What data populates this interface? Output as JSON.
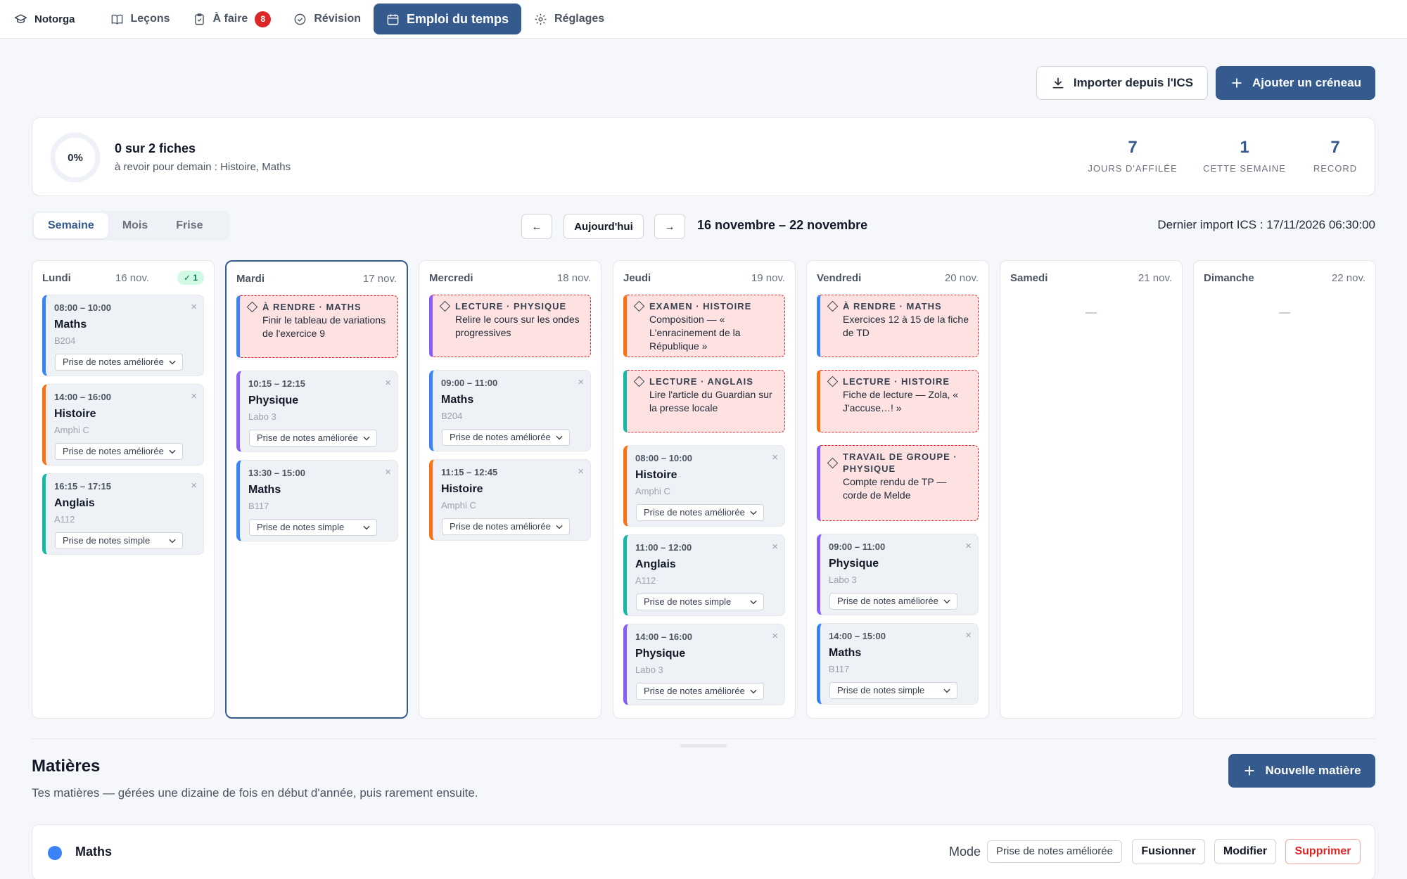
{
  "colors": {
    "accent": "#345a8e",
    "maths": "#3b82f6",
    "physique": "#8b5cf6",
    "histoire": "#f97316",
    "anglais": "#14b8a6",
    "danger": "#dc2626"
  },
  "nav": {
    "brand": "Notorga",
    "items": [
      {
        "label": "Leçons",
        "icon": "book-icon"
      },
      {
        "label": "À faire",
        "icon": "clipboard-icon",
        "badge": "8"
      },
      {
        "label": "Révision",
        "icon": "check-circle-icon"
      },
      {
        "label": "Emploi du temps",
        "icon": "calendar-icon",
        "active": true
      },
      {
        "label": "Réglages",
        "icon": "gear-icon"
      }
    ]
  },
  "actions": {
    "import_label": "Importer depuis l'ICS",
    "add_slot_label": "Ajouter un créneau"
  },
  "progress": {
    "percent_label": "0%",
    "percent": 0,
    "title": "0 sur 2 fiches",
    "subtitle": "à revoir pour demain : Histoire, Maths",
    "stats": [
      {
        "value": "7",
        "label": "Jours d'affilée"
      },
      {
        "value": "1",
        "label": "Cette semaine"
      },
      {
        "value": "7",
        "label": "Record"
      }
    ]
  },
  "toolbar": {
    "views": [
      "Semaine",
      "Mois",
      "Frise"
    ],
    "active_view": "Semaine",
    "prev": "←",
    "today": "Aujourd'hui",
    "next": "→",
    "range": "16 novembre – 22 novembre",
    "last_import": "Dernier import ICS : 17/11/2026 06:30:00"
  },
  "week": [
    {
      "name": "Lundi",
      "date": "16 nov.",
      "check": "✓ 1",
      "tasks": [],
      "slots": [
        {
          "time": "08:00 – 10:00",
          "subject": "Maths",
          "room": "B204",
          "mode": "Prise de notes améliorée",
          "color": "maths"
        },
        {
          "time": "14:00 – 16:00",
          "subject": "Histoire",
          "room": "Amphi C",
          "mode": "Prise de notes améliorée",
          "color": "histoire"
        },
        {
          "time": "16:15 – 17:15",
          "subject": "Anglais",
          "room": "A112",
          "mode": "Prise de notes simple",
          "color": "anglais"
        }
      ]
    },
    {
      "name": "Mardi",
      "date": "17 nov.",
      "today": true,
      "tasks": [
        {
          "kind": "À RENDRE · MATHS",
          "desc": "Finir le tableau de variations de l'exercice 9",
          "color": "maths"
        }
      ],
      "slots": [
        {
          "time": "10:15 – 12:15",
          "subject": "Physique",
          "room": "Labo 3",
          "mode": "Prise de notes améliorée",
          "color": "physique"
        },
        {
          "time": "13:30 – 15:00",
          "subject": "Maths",
          "room": "B117",
          "mode": "Prise de notes simple",
          "color": "maths"
        }
      ]
    },
    {
      "name": "Mercredi",
      "date": "18 nov.",
      "tasks": [
        {
          "kind": "LECTURE · PHYSIQUE",
          "desc": "Relire le cours sur les ondes progressives",
          "color": "physique"
        }
      ],
      "slots": [
        {
          "time": "09:00 – 11:00",
          "subject": "Maths",
          "room": "B204",
          "mode": "Prise de notes améliorée",
          "color": "maths"
        },
        {
          "time": "11:15 – 12:45",
          "subject": "Histoire",
          "room": "Amphi C",
          "mode": "Prise de notes améliorée",
          "color": "histoire"
        }
      ]
    },
    {
      "name": "Jeudi",
      "date": "19 nov.",
      "tasks": [
        {
          "kind": "EXAMEN · HISTOIRE",
          "desc": "Composition — « L'enracinement de la République »",
          "color": "histoire"
        },
        {
          "kind": "LECTURE · ANGLAIS",
          "desc": "Lire l'article du Guardian sur la presse locale",
          "color": "anglais"
        }
      ],
      "slots": [
        {
          "time": "08:00 – 10:00",
          "subject": "Histoire",
          "room": "Amphi C",
          "mode": "Prise de notes améliorée",
          "color": "histoire"
        },
        {
          "time": "11:00 – 12:00",
          "subject": "Anglais",
          "room": "A112",
          "mode": "Prise de notes simple",
          "color": "anglais"
        },
        {
          "time": "14:00 – 16:00",
          "subject": "Physique",
          "room": "Labo 3",
          "mode": "Prise de notes améliorée",
          "color": "physique"
        }
      ]
    },
    {
      "name": "Vendredi",
      "date": "20 nov.",
      "tasks": [
        {
          "kind": "À RENDRE · MATHS",
          "desc": "Exercices 12 à 15 de la fiche de TD",
          "color": "maths"
        },
        {
          "kind": "LECTURE · HISTOIRE",
          "desc": "Fiche de lecture — Zola, « J'accuse…! »",
          "color": "histoire"
        },
        {
          "kind": "TRAVAIL DE GROUPE · PHYSIQUE",
          "desc": "Compte rendu de TP — corde de Melde",
          "color": "physique"
        }
      ],
      "slots": [
        {
          "time": "09:00 – 11:00",
          "subject": "Physique",
          "room": "Labo 3",
          "mode": "Prise de notes améliorée",
          "color": "physique"
        },
        {
          "time": "14:00 – 15:00",
          "subject": "Maths",
          "room": "B117",
          "mode": "Prise de notes simple",
          "color": "maths"
        }
      ]
    },
    {
      "name": "Samedi",
      "date": "21 nov.",
      "empty": "—",
      "tasks": [],
      "slots": []
    },
    {
      "name": "Dimanche",
      "date": "22 nov.",
      "empty": "—",
      "tasks": [],
      "slots": []
    }
  ],
  "subjects": {
    "title": "Matières",
    "subtitle": "Tes matières — gérées une dizaine de fois en début d'année, puis rarement ensuite.",
    "new_label": "Nouvelle matière",
    "items": [
      {
        "name": "Maths",
        "color": "maths",
        "mode_label": "Mode",
        "mode": "Prise de notes améliorée",
        "merge": "Fusionner",
        "edit": "Modifier",
        "delete": "Supprimer"
      }
    ]
  }
}
